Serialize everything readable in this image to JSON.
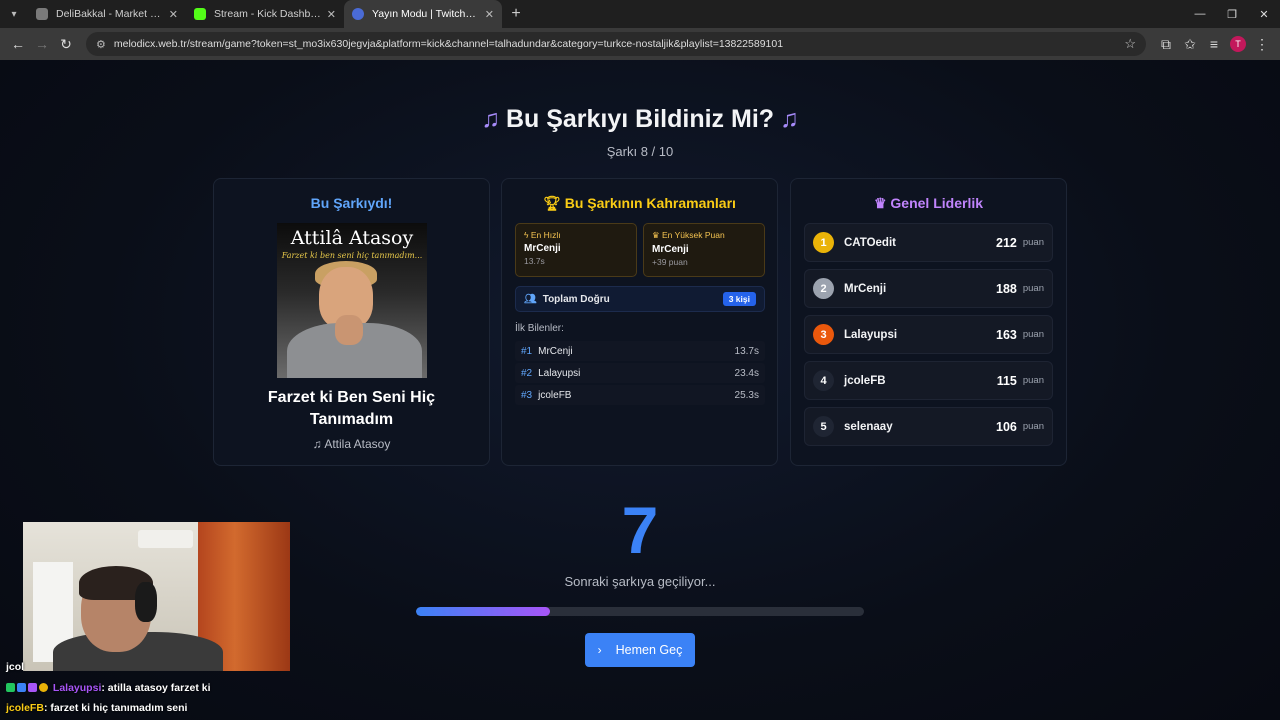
{
  "browser": {
    "tabs": [
      {
        "title": "DeliBakkal - Market Otomasyonu",
        "color": "#7a7a7a"
      },
      {
        "title": "Stream - Kick Dashboard",
        "color": "#53fc18"
      },
      {
        "title": "Yayın Modu | Twitch ve Kick ile",
        "color": "#4a6bd6"
      }
    ],
    "url": "melodicx.web.tr/stream/game?token=st_mo3ix630jegvja&platform=kick&channel=talhadundar&category=turkce-nostaljik&playlist=13822589101",
    "profile_initial": "T"
  },
  "header": {
    "title": "Bu Şarkıyı Bildiniz Mi?",
    "subtitle": "Şarkı 8 / 10"
  },
  "song_card": {
    "title": "Bu Şarkıydı!",
    "album_artist_text": "Attilâ Atasoy",
    "album_subtitle_text": "Farzet ki ben seni hiç tanımadım...",
    "song_name": "Farzet ki Ben Seni Hiç Tanımadım",
    "artist": "Attila Atasoy"
  },
  "heroes_card": {
    "title": "Bu Şarkının Kahramanları",
    "fastest": {
      "label": "En Hızlı",
      "name": "MrCenji",
      "value": "13.7s"
    },
    "highest": {
      "label": "En Yüksek Puan",
      "name": "MrCenji",
      "value": "+39 puan"
    },
    "total_label": "Toplam Doğru",
    "total_badge": "3 kişi",
    "first_label": "İlk Bilenler:",
    "first": [
      {
        "rank": "#1",
        "name": "MrCenji",
        "time": "13.7s"
      },
      {
        "rank": "#2",
        "name": "Lalayupsi",
        "time": "23.4s"
      },
      {
        "rank": "#3",
        "name": "jcoleFB",
        "time": "25.3s"
      }
    ]
  },
  "leaderboard": {
    "title": "Genel Liderlik",
    "unit": "puan",
    "rows": [
      {
        "rank": "1",
        "name": "CATOedit",
        "points": "212",
        "color": "#eab308"
      },
      {
        "rank": "2",
        "name": "MrCenji",
        "points": "188",
        "color": "#9ca3af"
      },
      {
        "rank": "3",
        "name": "Lalayupsi",
        "points": "163",
        "color": "#ea580c"
      },
      {
        "rank": "4",
        "name": "jcoleFB",
        "points": "115",
        "color": "#1f2533"
      },
      {
        "rank": "5",
        "name": "selenaay",
        "points": "106",
        "color": "#1f2533"
      }
    ]
  },
  "countdown": {
    "number": "7",
    "text": "Sonraki şarkıya geçiliyor...",
    "progress": 0.3,
    "button": "Hemen Geç"
  },
  "chat": {
    "line0": "jcol",
    "line1_user": "Lalayupsi",
    "line1_msg": ": atilla atasoy farzet ki",
    "line2_user": "jcoleFB",
    "line2_msg": ": farzet ki hiç tanımadım seni"
  },
  "colors": {
    "accent": "#3b82f6",
    "purple": "#a855f7",
    "gold": "#facc15"
  }
}
